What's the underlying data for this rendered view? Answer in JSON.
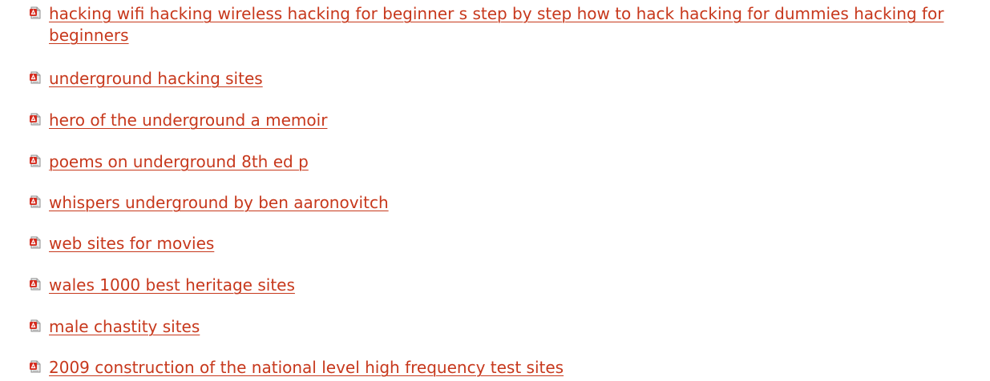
{
  "colors": {
    "link": "#c7381c",
    "icon_red": "#d52b1e",
    "icon_page": "#e9e9e9"
  },
  "icons": {
    "file": "pdf-file-icon"
  },
  "links": [
    {
      "text": "hacking wifi hacking wireless hacking for beginner s step by step how to hack hacking for dummies hacking for beginners"
    },
    {
      "text": "underground hacking sites"
    },
    {
      "text": "hero of the underground a memoir"
    },
    {
      "text": "poems on underground 8th ed p"
    },
    {
      "text": "whispers underground by ben aaronovitch"
    },
    {
      "text": "web sites for movies"
    },
    {
      "text": "wales 1000 best heritage sites"
    },
    {
      "text": "male chastity sites"
    },
    {
      "text": "2009 construction of the national level high frequency test sites"
    }
  ]
}
